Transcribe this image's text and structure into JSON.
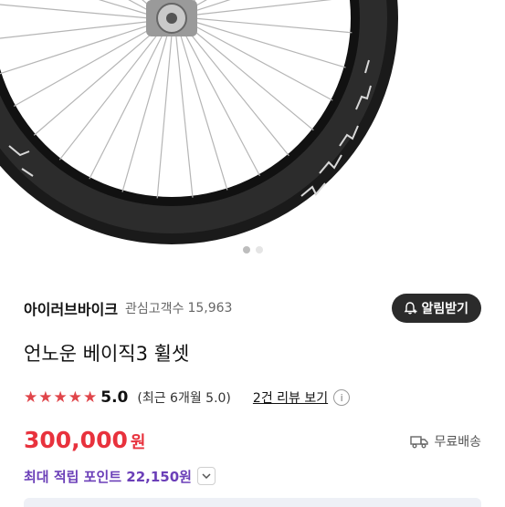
{
  "product_image": {
    "alt": "wheel-photo",
    "dots": [
      {
        "active": true
      },
      {
        "active": false
      }
    ]
  },
  "store": {
    "name": "아이러브바이크",
    "watch_label": "관심고객수",
    "watch_count": "15,963",
    "alarm_button": "알림받기"
  },
  "product": {
    "title": "언노운 베이직3 휠셋"
  },
  "rating": {
    "stars": 5,
    "score": "5.0",
    "recent": "(최근 6개월 5.0)",
    "review_link": "2건 리뷰 보기",
    "info_icon": "i"
  },
  "price": {
    "amount": "300,000",
    "unit": "원",
    "shipping": "무료배송"
  },
  "points": {
    "label": "최대 적립 포인트 22,150원"
  },
  "colors": {
    "price": "#e8323d",
    "points": "#6b3fb8",
    "star": "#e0454a",
    "button_bg": "#2b2b2b"
  }
}
